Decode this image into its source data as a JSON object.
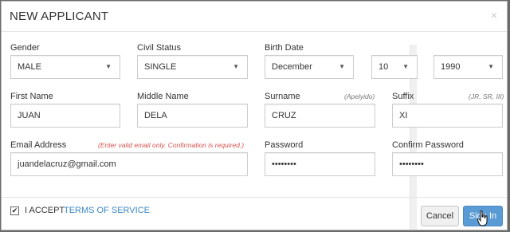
{
  "modal": {
    "title": "NEW APPLICANT",
    "close_glyph": "×"
  },
  "form": {
    "gender": {
      "label": "Gender",
      "value": "MALE"
    },
    "civil_status": {
      "label": "Civil Status",
      "value": "SINGLE"
    },
    "birth_date": {
      "label": "Birth Date",
      "month": "December",
      "day": "10",
      "year": "1990"
    },
    "first_name": {
      "label": "First Name",
      "value": "JUAN"
    },
    "middle_name": {
      "label": "Middle Name",
      "value": "DELA"
    },
    "surname": {
      "label": "Surname",
      "hint": "(Apelyido)",
      "value": "CRUZ"
    },
    "suffix": {
      "label": "Suffix",
      "hint": "(JR, SR, III)",
      "value": "XI"
    },
    "email": {
      "label": "Email Address",
      "hint": "(Enter valid email only. Confirmation is required.)",
      "value": "juandelacruz@gmail.com"
    },
    "password": {
      "label": "Password",
      "value": "••••••••"
    },
    "confirm_password": {
      "label": "Confirm Password",
      "value": "••••••••"
    }
  },
  "footer": {
    "checkbox_checked": true,
    "accept_text": "I ACCEPT",
    "tos_link": "TERMS OF SERVICE",
    "cancel_label": "Cancel",
    "signin_label": "Sign In"
  },
  "colors": {
    "accent": "#5b9bd5",
    "link": "#3a87c8",
    "warning": "#d9534f"
  }
}
